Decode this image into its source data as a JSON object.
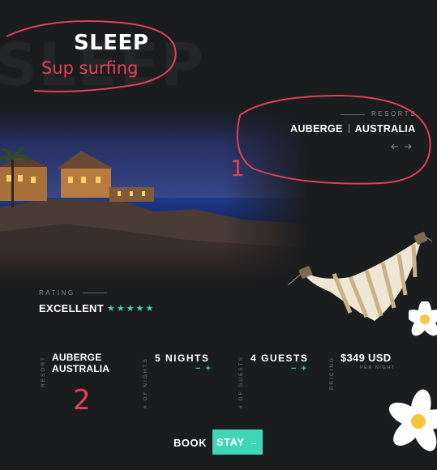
{
  "header": {
    "background_word": "SLEEP",
    "title": "SLEEP",
    "subtitle": "Sup surfing"
  },
  "resorts": {
    "label": "RESORTS",
    "name": "AUBERGE",
    "location": "AUSTRALIA",
    "prev_icon": "arrow-left-icon",
    "next_icon": "arrow-right-icon"
  },
  "rating": {
    "label": "RATING",
    "value": "EXCELLENT",
    "stars": "★★★★★",
    "star_count": 5
  },
  "info": {
    "resort_label": "RESORT",
    "resort_line1": "AUBERGE",
    "resort_line2": "AUSTRALIA",
    "nights_label": "# OF NIGHTS",
    "nights_value": "5 NIGHTS",
    "guests_label": "# OF GUESTS",
    "guests_value": "4 GUESTS",
    "stepper_minus": "−",
    "stepper_plus": "+",
    "pricing_label": "PRICING",
    "price": "$349 USD",
    "price_unit": "PER NIGHT"
  },
  "cta": {
    "book_label": "BOOK",
    "stay_label": "STAY",
    "arrow": "→"
  },
  "annotations": {
    "marker_1": "1",
    "marker_2": "2"
  },
  "colors": {
    "background": "#1b1c1e",
    "accent": "#3fd6b4",
    "annotation": "#e0405a"
  }
}
